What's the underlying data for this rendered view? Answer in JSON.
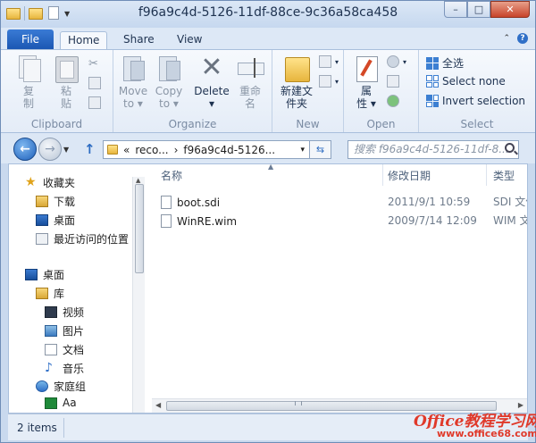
{
  "window": {
    "title": "f96a9c4d-5126-11df-88ce-9c36a58ca458",
    "controls": {
      "minimize": "–",
      "maximize": "□",
      "close": "✕"
    }
  },
  "ribbon_tabs": {
    "file": "File",
    "home": "Home",
    "share": "Share",
    "view": "View",
    "active": "Home"
  },
  "ribbon": {
    "clipboard": {
      "label": "Clipboard",
      "copy": "复\n制",
      "paste": "粘\n贴"
    },
    "organize": {
      "label": "Organize",
      "move_to": "Move\nto ▾",
      "copy_to": "Copy\nto ▾",
      "delete": "Delete",
      "delete_arrow": "▾",
      "rename": "重命\n名"
    },
    "new": {
      "label": "New",
      "new_folder": "新建文\n件夹"
    },
    "open": {
      "label": "Open",
      "properties": "属\n性 ▾"
    },
    "select": {
      "label": "Select",
      "select_all": "全选",
      "select_none": "Select none",
      "invert_selection": "Invert selection"
    }
  },
  "address": {
    "prefix": "«",
    "segment1": "reco...",
    "sep": "›",
    "segment2": "f96a9c4d-5126...",
    "dropdown": "▾",
    "refresh": "⇆",
    "search_placeholder": "搜索 f96a9c4d-5126-11df-8..."
  },
  "nav_pane": {
    "favorites": "收藏夹",
    "downloads": "下载",
    "desktop_fav": "桌面",
    "recent": "最近访问的位置",
    "desktop": "桌面",
    "libraries": "库",
    "videos": "视频",
    "pictures": "图片",
    "documents": "文档",
    "music": "音乐",
    "homegroup": "家庭组",
    "user": "Aa"
  },
  "columns": {
    "name": "名称",
    "date": "修改日期",
    "type": "类型"
  },
  "files": [
    {
      "name": "boot.sdi",
      "date": "2011/9/1 10:59",
      "type": "SDI 文件"
    },
    {
      "name": "WinRE.wim",
      "date": "2009/7/14 12:09",
      "type": "WIM 文件"
    }
  ],
  "status": {
    "count": "2 items"
  },
  "watermark": {
    "line1": "Office教程学习网",
    "line2": "www.office68.com"
  }
}
